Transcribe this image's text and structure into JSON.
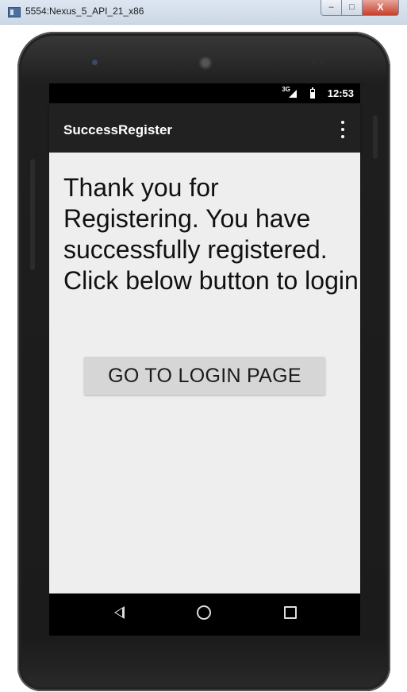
{
  "window": {
    "title": "5554:Nexus_5_API_21_x86",
    "minimize_glyph": "–",
    "maximize_glyph": "□",
    "close_glyph": "X"
  },
  "status_bar": {
    "network": "3G",
    "time": "12:53"
  },
  "app_bar": {
    "title": "SuccessRegister",
    "menu_icon": "overflow-menu-icon"
  },
  "content": {
    "message": "Thank you for Registering. You have successfully registered. Click below button to login",
    "login_button_label": "GO TO LOGIN PAGE"
  },
  "nav_bar": {
    "icons": [
      "back-icon",
      "home-icon",
      "recents-icon"
    ]
  },
  "colors": {
    "app_bar": "#212121",
    "content_background": "#eeeeee",
    "button": "#d6d6d6"
  }
}
